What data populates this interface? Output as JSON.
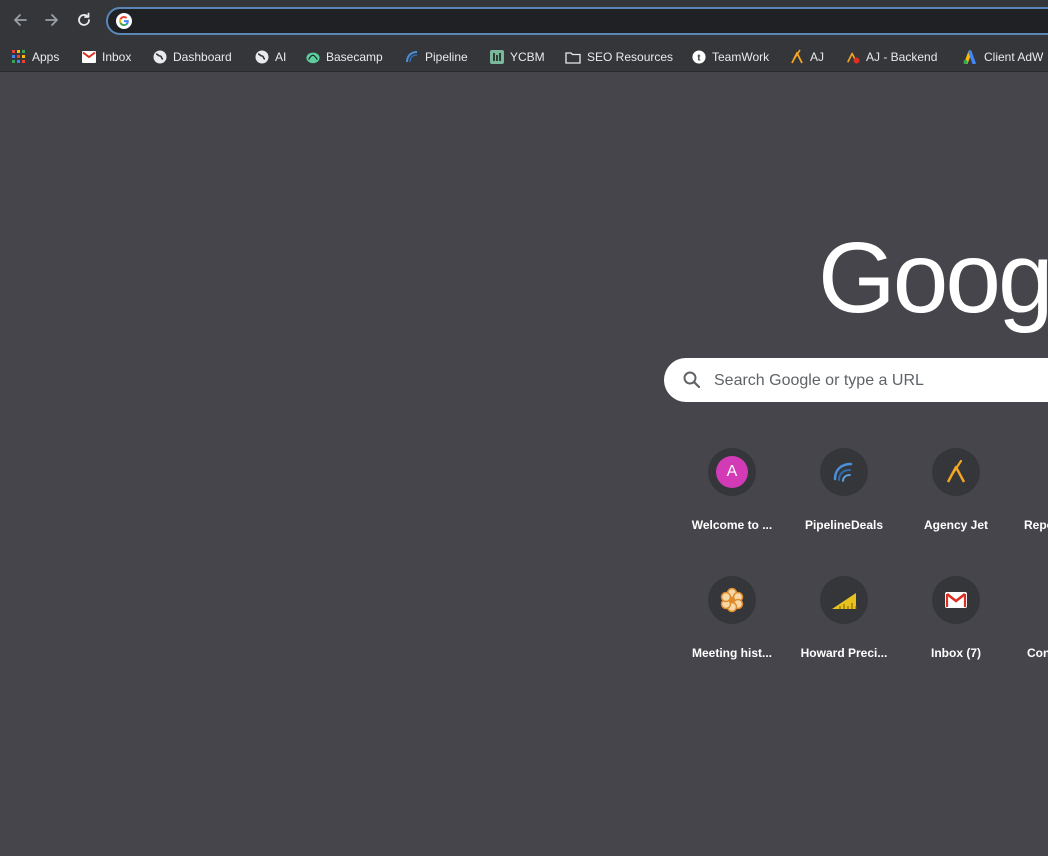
{
  "omnibox": {
    "value": "",
    "placeholder": ""
  },
  "bookmarks": [
    {
      "label": "Apps",
      "icon": "apps-grid-icon"
    },
    {
      "label": "Inbox",
      "icon": "gmail-icon"
    },
    {
      "label": "Dashboard",
      "icon": "globe-icon"
    },
    {
      "label": "AI",
      "icon": "globe-icon"
    },
    {
      "label": "Basecamp",
      "icon": "basecamp-icon"
    },
    {
      "label": "Pipeline",
      "icon": "pipeline-icon"
    },
    {
      "label": "YCBM",
      "icon": "ycbm-icon"
    },
    {
      "label": "SEO Resources",
      "icon": "folder-icon"
    },
    {
      "label": "TeamWork",
      "icon": "teamwork-icon"
    },
    {
      "label": "AJ",
      "icon": "agency-jet-icon"
    },
    {
      "label": "AJ - Backend",
      "icon": "agency-jet-backend-icon"
    },
    {
      "label": "Client AdW",
      "icon": "google-ads-icon"
    }
  ],
  "logo_text": "Googl",
  "search": {
    "placeholder": "Search Google or type a URL"
  },
  "shortcuts": [
    {
      "label": "Welcome to ...",
      "icon": "avatar-a-icon",
      "initial": "A"
    },
    {
      "label": "PipelineDeals",
      "icon": "pipelinedeals-icon"
    },
    {
      "label": "Agency Jet",
      "icon": "agency-jet-icon"
    },
    {
      "label": "Repo",
      "icon": ""
    },
    {
      "label": "Meeting hist...",
      "icon": "meeting-flower-icon"
    },
    {
      "label": "Howard Preci...",
      "icon": "howard-ruler-icon"
    },
    {
      "label": "Inbox (7)",
      "icon": "gmail-icon"
    },
    {
      "label": "Con",
      "icon": ""
    }
  ],
  "colors": {
    "page_bg": "#47454c",
    "toolbar_bg": "#35363a",
    "omnibox_border": "#5a86b8",
    "avatar_pink": "#d23bb5"
  }
}
